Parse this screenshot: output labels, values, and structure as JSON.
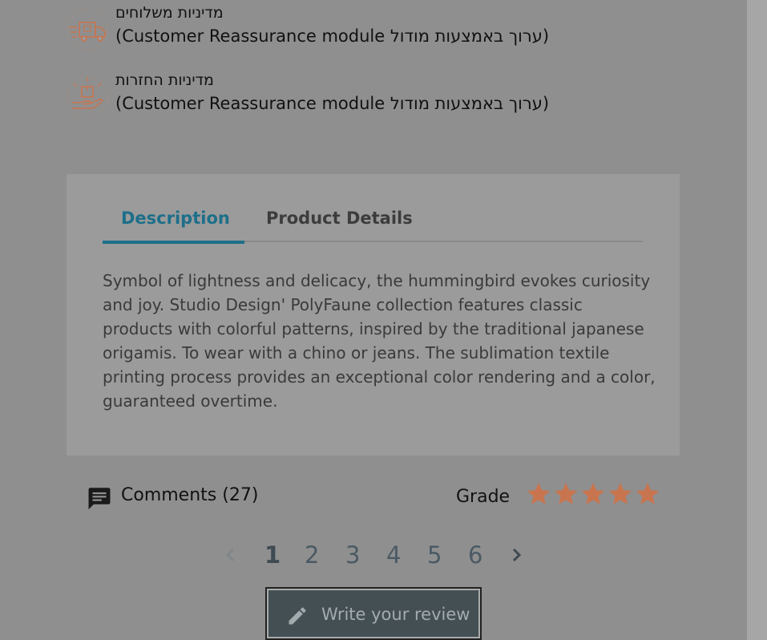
{
  "reassurance": [
    {
      "title": "מדיניות משלוחים",
      "description": "(ערוך באמצעות מודול Customer Reassurance module)",
      "icon": "delivery-truck-icon"
    },
    {
      "title": "מדיניות החזרות",
      "description": "(ערוך באמצעות מודול Customer Reassurance module)",
      "icon": "return-box-hand-icon"
    }
  ],
  "tabs": [
    {
      "label": "Description",
      "active": true
    },
    {
      "label": "Product Details",
      "active": false
    }
  ],
  "description_text": "Symbol of lightness and delicacy, the hummingbird evokes curiosity and joy. Studio Design' PolyFaune collection features classic products with colorful patterns, inspired by the traditional japanese origamis. To wear with a chino or jeans. The sublimation textile printing process provides an exceptional color rendering and a color, guaranteed overtime.",
  "comments": {
    "label": "Comments (27)",
    "icon": "comment-icon"
  },
  "grade": {
    "label": "Grade",
    "stars_filled": 5,
    "stars_total": 5,
    "star_color": "#c8754f"
  },
  "pagination": {
    "pages": [
      "1",
      "2",
      "3",
      "4",
      "5",
      "6"
    ],
    "current": "1",
    "prev_icon": "chevron-left-icon",
    "next_icon": "chevron-right-icon"
  },
  "review_button": {
    "label": "Write your review",
    "icon": "pencil-icon"
  },
  "colors": {
    "accent": "#1d6f8a",
    "icon_accent": "#c8754f",
    "button_bg": "#444f54"
  }
}
